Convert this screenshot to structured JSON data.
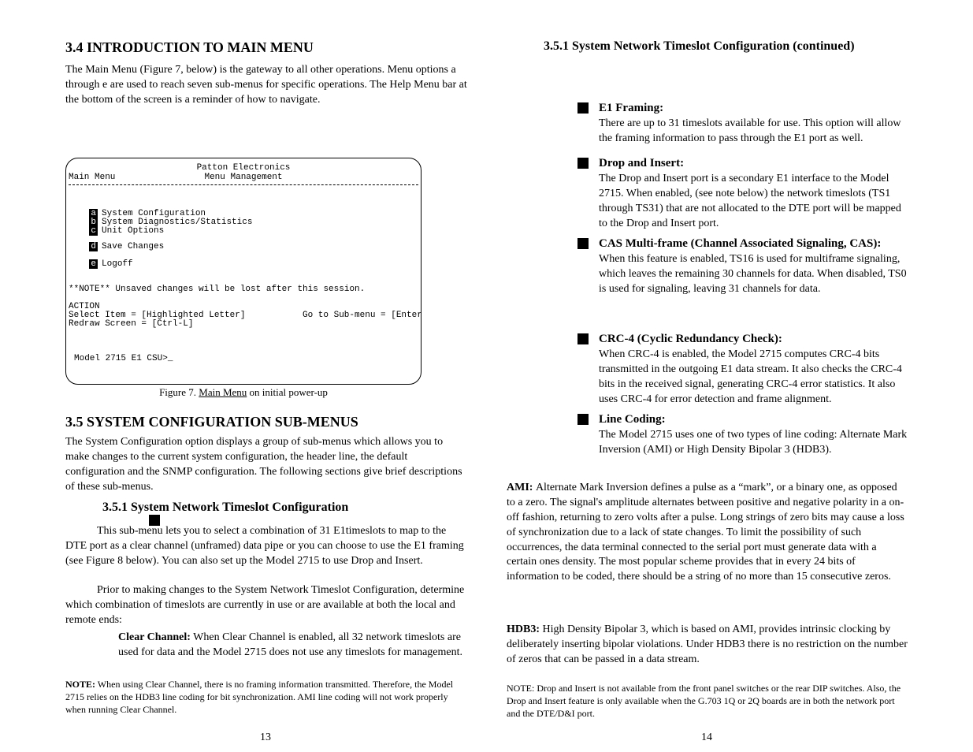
{
  "left": {
    "section_title": "3.4 INTRODUCTION TO MAIN MENU",
    "section_body": "The Main Menu (Figure 7, below) is the gateway to all other operations. Menu options a through e are used to reach seven sub-menus for specific operations.  The Help Menu bar at the bottom of the screen is a reminder of how to navigate.",
    "section3_5": "3.5  SYSTEM CONFIGURATION SUB-MENUS",
    "section3_5_body": "The System Configuration option displays a group of sub-menus which allows you to make changes to the current system configuration, the header line, the default configuration and the SNMP configuration. The following sections give brief descriptions of these sub-menus.",
    "section3_5_1": "3.5.1 System Network Timeslot Configuration",
    "section3_5_1_body_top": "This sub-menu lets you to select a combination of 31 E1timeslots to map to the DTE port as a clear channel (unframed) data pipe or you can choose to use the E1 framing (see Figure 8 below). You can also set up the Model 2715 to use Drop and Insert.",
    "section3_5_1_body_bottom": "Prior to making changes to the System Network Timeslot Configuration, determine which combination of timeslots are currently in use or are available at both the local and remote ends:",
    "bullet_heading": "Clear Channel:",
    "bullet_body": " When Clear Channel is enabled, all 32 network timeslots are used for data and the Model 2715 does not use any timeslots for management.",
    "note_label": "NOTE:",
    "note_body": "  When using Clear Channel, there is no framing information transmitted. Therefore, the Model 2715 relies on the HDB3 line coding for bit synchronization. AMI line coding will not work properly when running Clear Channel.",
    "page_num": "13"
  },
  "figure": {
    "header_company": "Patton Electronics",
    "header_menu": "Menu Management",
    "location": "Main Menu",
    "items": [
      {
        "key": "a",
        "label": "System Configuration"
      },
      {
        "key": "b",
        "label": "System Diagnostics/Statistics"
      },
      {
        "key": "c",
        "label": "Unit Options"
      },
      {
        "key": "d",
        "label": "Save Changes"
      },
      {
        "key": "e",
        "label": "Logoff"
      }
    ],
    "note_stars": "**NOTE** Unsaved changes will be lost after this session.",
    "action_header": "ACTION",
    "action_left": "Select Item = [Highlighted Letter]",
    "action_right": "Go to Sub-menu = [Enter]",
    "action_redraw": "Redraw Screen = [Ctrl-L]",
    "prompt": "Model 2715 E1 CSU>_",
    "caption_plain": "Figure 7. ",
    "caption_under": "Main Menu",
    "caption_rest": " on initial power-up"
  },
  "right": {
    "page_num": "14",
    "section": "3.5.1 System Network Timeslot Configuration (continued)",
    "items": [
      {
        "heading": "E1 Framing:",
        "body": " There are up to 31 timeslots available for use. This option will allow the framing information to pass through the E1 port as well."
      },
      {
        "heading": "Drop and Insert:",
        "body": " The Drop and Insert port is a secondary E1 interface to the Model 2715. When enabled, (see note below) the network timeslots (TS1 through TS31) that are not allocated to the DTE port will be mapped to the Drop and Insert port."
      },
      {
        "heading": "CAS Multi-frame (Channel Associated Signaling, CAS):",
        "body": " When this feature is enabled, TS16 is used for multiframe signaling, which leaves the remaining 30 channels for data. When disabled, TS0 is used for signaling, leaving 31 channels for data."
      },
      {
        "heading": "CRC-4 (Cyclic Redundancy Check):",
        "body": " When CRC-4 is enabled, the Model 2715 computes CRC-4 bits transmitted in the outgoing E1 data stream. It also checks the CRC-4 bits in the received signal, generating CRC-4 error statistics. It also uses CRC-4 for error detection and frame alignment."
      },
      {
        "heading": "Line Coding:",
        "body": " The Model 2715 uses one of two types of line coding: Alternate Mark Inversion (AMI) or High Density Bipolar 3 (HDB3)."
      }
    ],
    "ami_label": "AMI: ",
    "ami_body": "Alternate Mark Inversion defines a pulse as a “mark”, or a binary one, as opposed to a zero.  The signal's amplitude alternates between positive and negative polarity in a on-off fashion, returning to zero volts after a pulse. Long strings of zero bits may cause a loss of synchronization due to a lack of state changes. To limit the possibility of such occurrences, the data terminal connected to the serial port must generate data with a certain ones density. The most popular scheme provides that in every 24 bits of information to be coded, there should be a string of no more than 15 consecutive zeros.",
    "hdb3_label": "HDB3: ",
    "hdb3_body": "High Density Bipolar 3, which is based on AMI, provides intrinsic clocking by deliberately inserting bipolar violations. Under HDB3 there is no restriction on the number of zeros that can be passed in a data stream.",
    "footnote": "NOTE: Drop and Insert is not available from the front panel switches or the rear DIP switches. Also, the Drop and Insert feature is only available when the G.703 1Q or 2Q boards are in both the network port and the DTE/D&I port."
  }
}
